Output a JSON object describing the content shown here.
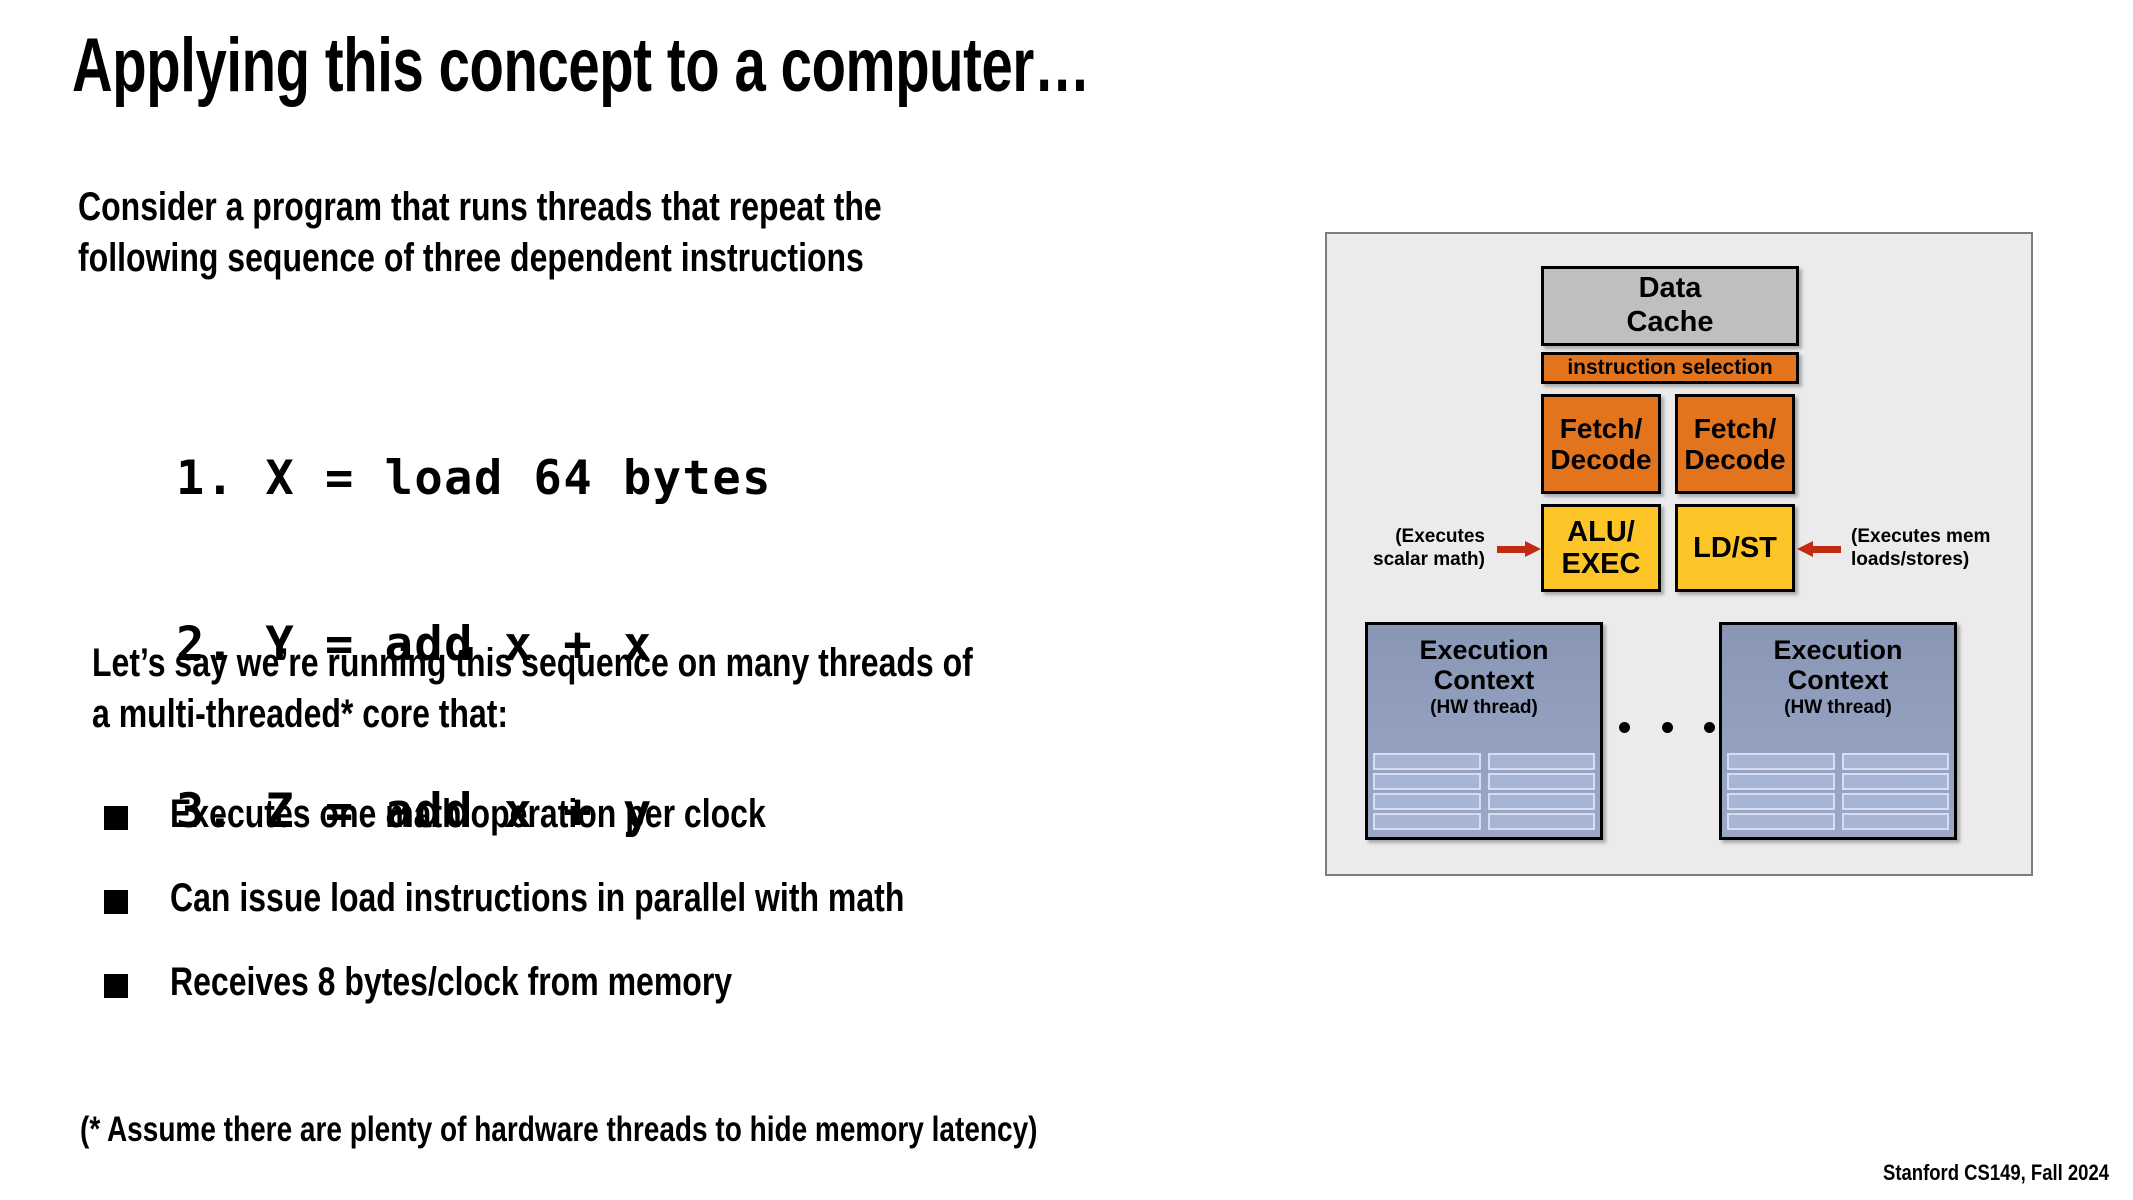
{
  "slide": {
    "title": "Applying this concept to a computer…",
    "attribution": "Stanford CS149, Fall 2024"
  },
  "body": {
    "intro_paragraph": "Consider a program that runs threads that repeat the\nfollowing sequence of three dependent instructions",
    "code_lines": [
      "1. X = load 64 bytes",
      "2. Y = add x + x",
      "3. Z = add x + y"
    ],
    "premise_paragraph": "Let’s say we’re running this sequence on many threads of\na multi-threaded* core that:",
    "bullets": [
      "Executes one math operation per clock",
      "Can issue load instructions in parallel with math",
      "Receives 8 bytes/clock from memory"
    ],
    "footnote": "(* Assume there are plenty of hardware threads to hide memory latency)"
  },
  "diagram": {
    "data_cache": "Data\nCache",
    "instruction_selection": "instruction selection",
    "fetch_decode": [
      "Fetch/\nDecode",
      "Fetch/\nDecode"
    ],
    "alu_exec": "ALU/\nEXEC",
    "ld_st": "LD/ST",
    "annotation_left": "(Executes\nscalar math)",
    "annotation_right": "(Executes mem\nloads/stores)",
    "execution_contexts": [
      {
        "title": "Execution\nContext",
        "subtitle": "(HW thread)"
      },
      {
        "title": "Execution\nContext",
        "subtitle": "(HW thread)"
      }
    ],
    "ellipsis": "• • •",
    "colors": {
      "panel_background": "#ebebeb",
      "panel_border": "#7d7d7d",
      "data_cache": "#bfbfbf",
      "orange": "#e2741e",
      "yellow": "#fdc527",
      "exec_context": "#8a96b6",
      "register_cell": "#a7b5d5",
      "arrow": "#c02b12",
      "box_border": "#000000"
    }
  }
}
